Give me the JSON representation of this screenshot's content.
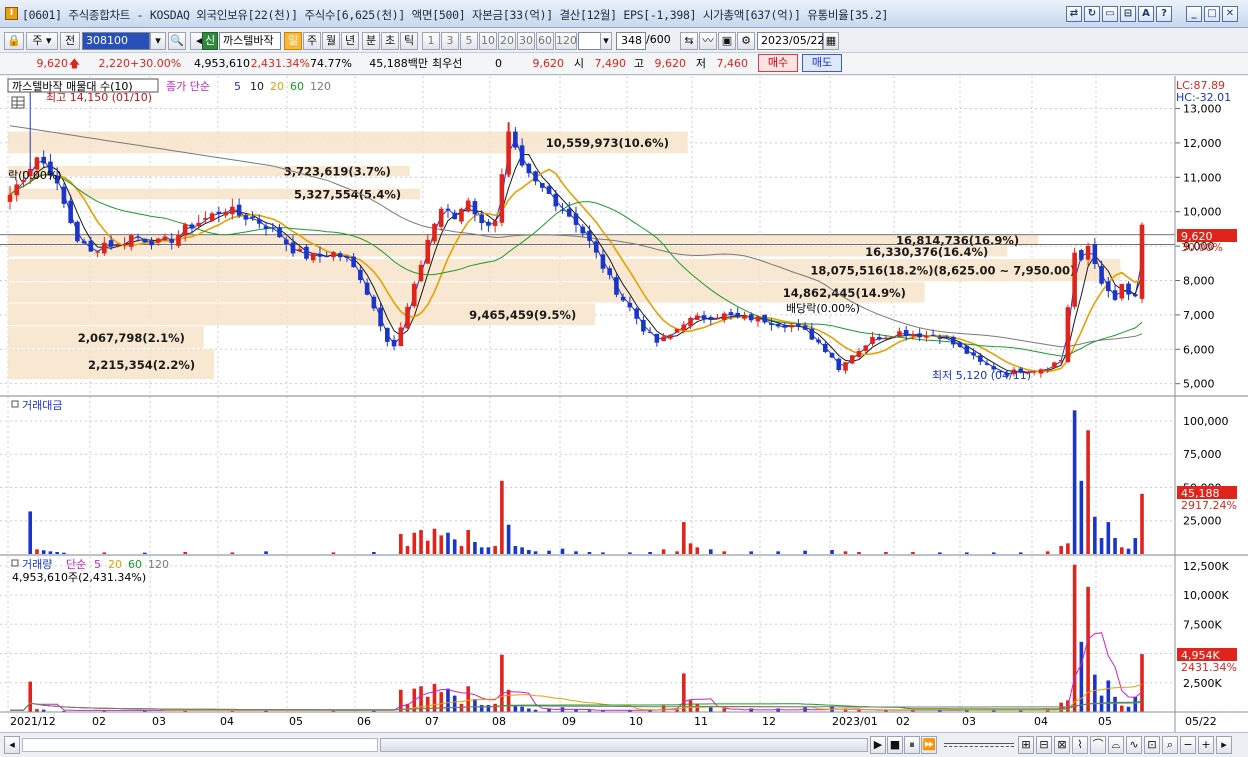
{
  "window": {
    "title": "[0601] 주식종합차트 - KOSDAQ 외국인보유[22(천)] 주식수[6,625(천)] 액면[500] 자본금[33(억)] 결산[12월] EPS[-1,398] 시가총액[637(억)] 유통비율[35.2]",
    "buttons": [
      "link-icon",
      "refresh-icon",
      "window-icon",
      "split-icon",
      "font-icon",
      "help-icon",
      "minimize-icon",
      "maximize-icon",
      "close-icon"
    ]
  },
  "toolbar": {
    "market": "주",
    "prev_label": "전",
    "code": "308100",
    "company": "까스텔바작",
    "new_badge": "신",
    "periods": [
      "일",
      "주",
      "월",
      "년",
      "분",
      "초",
      "틱"
    ],
    "active_period": "일",
    "intervals": [
      "1",
      "3",
      "5",
      "10",
      "20",
      "30",
      "60",
      "120"
    ],
    "count": "348",
    "count_total": "/600",
    "date": "2023/05/22"
  },
  "quote": {
    "price": "9,620",
    "change": "2,220",
    "change_pct": "+30.00%",
    "volume": "4,953,610",
    "vol_ratio": "2,431.34%",
    "turnover": "74.77%",
    "amount": "45,188백만",
    "best_bid_label": "최우선",
    "best_bid": "0",
    "best_price": "9,620",
    "open_label": "시",
    "open": "7,490",
    "high_label": "고",
    "high": "9,620",
    "low_label": "저",
    "low": "7,460",
    "buy_label": "매수",
    "sell_label": "매도"
  },
  "price_panel": {
    "legend_title": "까스텔바작 매물대 수(10)",
    "ma_label": "종가 단순",
    "ma_periods": [
      "5",
      "10",
      "20",
      "60",
      "120"
    ],
    "ma_colors": [
      "#2233cc",
      "#1a1a1a",
      "#e8a000",
      "#1a9c2a",
      "#7a7a7a"
    ],
    "lc": "LC:87.89",
    "hc": "HC:-32.01",
    "high_marker": "최고 14,150 (01/10)",
    "low_marker": "최저 5,120 (04/11)",
    "dividend_left": "락(0.00%)",
    "dividend_mid": "배당락(0.00%)",
    "last_price": "9,620",
    "last_pct": "30.00%",
    "y_ticks": [
      "13,000",
      "12,000",
      "11,000",
      "10,000",
      "9,000",
      "8,000",
      "7,000",
      "6,000",
      "5,000"
    ]
  },
  "volume_profile": [
    {
      "label": "3,723,619(3.7%)",
      "price_lo": 11000,
      "price_hi": 11330,
      "width": 0.39
    },
    {
      "label": "10,559,973(10.6%)",
      "price_lo": 11670,
      "price_hi": 12330,
      "width": 0.66
    },
    {
      "label": "5,327,554(5.4%)",
      "price_lo": 10330,
      "price_hi": 10670,
      "width": 0.4
    },
    {
      "label": "16,814,736(16.9%)",
      "price_lo": 9000,
      "price_hi": 9330,
      "width": 1.0
    },
    {
      "label": "16,330,376(16.4%)",
      "price_lo": 8670,
      "price_hi": 9000,
      "width": 0.97
    },
    {
      "label": "18,075,516(18.2%)(8,625.00 ~ 7,950.00)",
      "price_lo": 7950,
      "price_hi": 8625,
      "width": 1.08
    },
    {
      "label": "14,862,445(14.9%)",
      "price_lo": 7330,
      "price_hi": 7950,
      "width": 0.89
    },
    {
      "label": "9,465,459(9.5%)",
      "price_lo": 6670,
      "price_hi": 7330,
      "width": 0.57
    },
    {
      "label": "2,067,798(2.1%)",
      "price_lo": 6000,
      "price_hi": 6670,
      "width": 0.19
    },
    {
      "label": "2,215,354(2.2%)",
      "price_lo": 5100,
      "price_hi": 6000,
      "width": 0.2
    }
  ],
  "amount_panel": {
    "title": "거래대금",
    "y_ticks": [
      "100,000",
      "75,000",
      "50,000",
      "25,000"
    ],
    "last_value": "45,188",
    "last_pct": "2917.24%"
  },
  "volume_panel": {
    "title": "거래량",
    "ma_label": "단순",
    "ma_periods": [
      "5",
      "20",
      "60",
      "120"
    ],
    "ma_colors": [
      "#cc22cc",
      "#e8a000",
      "#1a9c2a",
      "#7a7a7a"
    ],
    "info": "4,953,610주(2,431.34%)",
    "y_ticks": [
      "12,500K",
      "10,000K",
      "7,500K",
      "5,000K",
      "2,500K"
    ],
    "last_value": "4,954K",
    "last_pct": "2431.34%"
  },
  "x_labels": [
    "2021/12",
    "02",
    "03",
    "04",
    "05",
    "06",
    "07",
    "08",
    "09",
    "10",
    "11",
    "12",
    "2023/01",
    "02",
    "03",
    "04",
    "05",
    "05/22"
  ],
  "chart_data": {
    "type": "candlestick",
    "x_labels": [
      "2021/12",
      "02",
      "03",
      "04",
      "05",
      "06",
      "07",
      "08",
      "09",
      "10",
      "11",
      "12",
      "2023/01",
      "02",
      "03",
      "04",
      "05"
    ],
    "price_ylim": [
      4700,
      13800
    ],
    "price_path": [
      [
        0,
        10500
      ],
      [
        4,
        11600
      ],
      [
        6,
        11200
      ],
      [
        8,
        10200
      ],
      [
        10,
        9200
      ],
      [
        12,
        8800
      ],
      [
        14,
        9100
      ],
      [
        16,
        9000
      ],
      [
        18,
        9300
      ],
      [
        20,
        9200
      ],
      [
        22,
        9100
      ],
      [
        24,
        9200
      ],
      [
        26,
        9500
      ],
      [
        28,
        9700
      ],
      [
        30,
        9900
      ],
      [
        32,
        10100
      ],
      [
        34,
        9900
      ],
      [
        36,
        9800
      ],
      [
        38,
        9600
      ],
      [
        40,
        9300
      ],
      [
        42,
        8900
      ],
      [
        44,
        8700
      ],
      [
        46,
        8700
      ],
      [
        48,
        8800
      ],
      [
        50,
        8600
      ],
      [
        52,
        8100
      ],
      [
        54,
        7200
      ],
      [
        56,
        6300
      ],
      [
        57,
        6100
      ],
      [
        58,
        6600
      ],
      [
        60,
        7800
      ],
      [
        62,
        9200
      ],
      [
        64,
        10100
      ],
      [
        66,
        9800
      ],
      [
        68,
        10400
      ],
      [
        70,
        9600
      ],
      [
        72,
        9800
      ],
      [
        74,
        12200
      ],
      [
        76,
        11200
      ],
      [
        78,
        10800
      ],
      [
        80,
        10500
      ],
      [
        82,
        10100
      ],
      [
        84,
        9700
      ],
      [
        86,
        9100
      ],
      [
        88,
        8400
      ],
      [
        90,
        7700
      ],
      [
        92,
        7200
      ],
      [
        94,
        6600
      ],
      [
        96,
        6200
      ],
      [
        98,
        6400
      ],
      [
        100,
        6800
      ],
      [
        102,
        6900
      ],
      [
        104,
        6950
      ],
      [
        106,
        7000
      ],
      [
        108,
        6900
      ],
      [
        110,
        6900
      ],
      [
        112,
        6850
      ],
      [
        114,
        6750
      ],
      [
        116,
        6700
      ],
      [
        118,
        6500
      ],
      [
        120,
        6200
      ],
      [
        122,
        5800
      ],
      [
        123,
        5400
      ],
      [
        124,
        5700
      ],
      [
        126,
        6000
      ],
      [
        128,
        6300
      ],
      [
        130,
        6400
      ],
      [
        132,
        6500
      ],
      [
        134,
        6450
      ],
      [
        136,
        6400
      ],
      [
        138,
        6400
      ],
      [
        140,
        6150
      ],
      [
        142,
        5900
      ],
      [
        144,
        5600
      ],
      [
        146,
        5450
      ],
      [
        148,
        5300
      ],
      [
        150,
        5400
      ],
      [
        152,
        5400
      ],
      [
        154,
        5500
      ],
      [
        156,
        5700
      ],
      [
        158,
        8800
      ],
      [
        159,
        8500
      ],
      [
        160,
        9000
      ],
      [
        161,
        8500
      ],
      [
        162,
        8000
      ],
      [
        163,
        7600
      ],
      [
        164,
        7400
      ],
      [
        165,
        7900
      ],
      [
        166,
        7500
      ],
      [
        167,
        7500
      ],
      [
        168,
        9620
      ]
    ],
    "amount_bars": [
      [
        3,
        32000
      ],
      [
        4,
        3500
      ],
      [
        5,
        2800
      ],
      [
        6,
        2000
      ],
      [
        7,
        1500
      ],
      [
        8,
        1000
      ],
      [
        14,
        1200
      ],
      [
        20,
        1000
      ],
      [
        26,
        1500
      ],
      [
        33,
        1200
      ],
      [
        38,
        2000
      ],
      [
        48,
        1200
      ],
      [
        54,
        1500
      ],
      [
        58,
        15000
      ],
      [
        59,
        6000
      ],
      [
        60,
        16000
      ],
      [
        61,
        18000
      ],
      [
        62,
        10000
      ],
      [
        63,
        19000
      ],
      [
        64,
        14000
      ],
      [
        65,
        16000
      ],
      [
        66,
        11000
      ],
      [
        67,
        6000
      ],
      [
        68,
        18000
      ],
      [
        69,
        9000
      ],
      [
        70,
        5000
      ],
      [
        71,
        5000
      ],
      [
        72,
        6000
      ],
      [
        73,
        55000
      ],
      [
        74,
        22000
      ],
      [
        75,
        6000
      ],
      [
        76,
        5000
      ],
      [
        77,
        3000
      ],
      [
        78,
        2000
      ],
      [
        80,
        2500
      ],
      [
        82,
        4000
      ],
      [
        84,
        2000
      ],
      [
        86,
        1500
      ],
      [
        88,
        1200
      ],
      [
        92,
        1200
      ],
      [
        95,
        1500
      ],
      [
        97,
        3500
      ],
      [
        99,
        2000
      ],
      [
        100,
        24000
      ],
      [
        101,
        8000
      ],
      [
        102,
        5000
      ],
      [
        104,
        3500
      ],
      [
        106,
        2000
      ],
      [
        110,
        2000
      ],
      [
        114,
        2000
      ],
      [
        118,
        2500
      ],
      [
        122,
        3000
      ],
      [
        124,
        2000
      ],
      [
        126,
        1500
      ],
      [
        130,
        1500
      ],
      [
        134,
        1500
      ],
      [
        138,
        1200
      ],
      [
        142,
        1200
      ],
      [
        146,
        1200
      ],
      [
        150,
        1200
      ],
      [
        154,
        2000
      ],
      [
        156,
        6000
      ],
      [
        157,
        8000
      ],
      [
        158,
        108000
      ],
      [
        159,
        55000
      ],
      [
        160,
        93000
      ],
      [
        161,
        28000
      ],
      [
        162,
        12000
      ],
      [
        163,
        24000
      ],
      [
        164,
        12000
      ],
      [
        165,
        5000
      ],
      [
        166,
        4000
      ],
      [
        167,
        12000
      ],
      [
        168,
        45188
      ]
    ],
    "volume_bars": [
      [
        3,
        2600
      ],
      [
        4,
        250
      ],
      [
        5,
        200
      ],
      [
        8,
        100
      ],
      [
        14,
        100
      ],
      [
        20,
        100
      ],
      [
        26,
        120
      ],
      [
        33,
        100
      ],
      [
        38,
        150
      ],
      [
        48,
        100
      ],
      [
        54,
        150
      ],
      [
        58,
        1900
      ],
      [
        59,
        700
      ],
      [
        60,
        2000
      ],
      [
        61,
        2200
      ],
      [
        62,
        1300
      ],
      [
        63,
        2400
      ],
      [
        64,
        1700
      ],
      [
        65,
        2000
      ],
      [
        66,
        1400
      ],
      [
        67,
        700
      ],
      [
        68,
        2200
      ],
      [
        69,
        1100
      ],
      [
        70,
        600
      ],
      [
        71,
        600
      ],
      [
        72,
        700
      ],
      [
        73,
        4900
      ],
      [
        74,
        1900
      ],
      [
        75,
        500
      ],
      [
        76,
        450
      ],
      [
        77,
        300
      ],
      [
        78,
        200
      ],
      [
        80,
        250
      ],
      [
        82,
        400
      ],
      [
        84,
        200
      ],
      [
        86,
        150
      ],
      [
        88,
        120
      ],
      [
        92,
        150
      ],
      [
        95,
        200
      ],
      [
        97,
        550
      ],
      [
        99,
        300
      ],
      [
        100,
        3300
      ],
      [
        101,
        1000
      ],
      [
        102,
        700
      ],
      [
        104,
        500
      ],
      [
        106,
        300
      ],
      [
        110,
        300
      ],
      [
        114,
        300
      ],
      [
        118,
        400
      ],
      [
        122,
        500
      ],
      [
        124,
        300
      ],
      [
        126,
        200
      ],
      [
        130,
        200
      ],
      [
        134,
        200
      ],
      [
        138,
        180
      ],
      [
        142,
        200
      ],
      [
        146,
        200
      ],
      [
        150,
        200
      ],
      [
        154,
        300
      ],
      [
        156,
        800
      ],
      [
        157,
        1000
      ],
      [
        158,
        12600
      ],
      [
        159,
        6000
      ],
      [
        160,
        10700
      ],
      [
        161,
        3200
      ],
      [
        162,
        1400
      ],
      [
        163,
        2700
      ],
      [
        164,
        1300
      ],
      [
        165,
        550
      ],
      [
        166,
        450
      ],
      [
        167,
        1300
      ],
      [
        168,
        4954
      ]
    ],
    "amount_ylim": [
      0,
      115000
    ],
    "volume_ylim": [
      0,
      13000
    ]
  },
  "bottom": {
    "nav_icons": [
      "play-icon",
      "stop-icon",
      "pause-icon",
      "fast-forward-icon"
    ],
    "tool_icons": [
      "search-minus-icon",
      "search-plus-icon"
    ]
  }
}
